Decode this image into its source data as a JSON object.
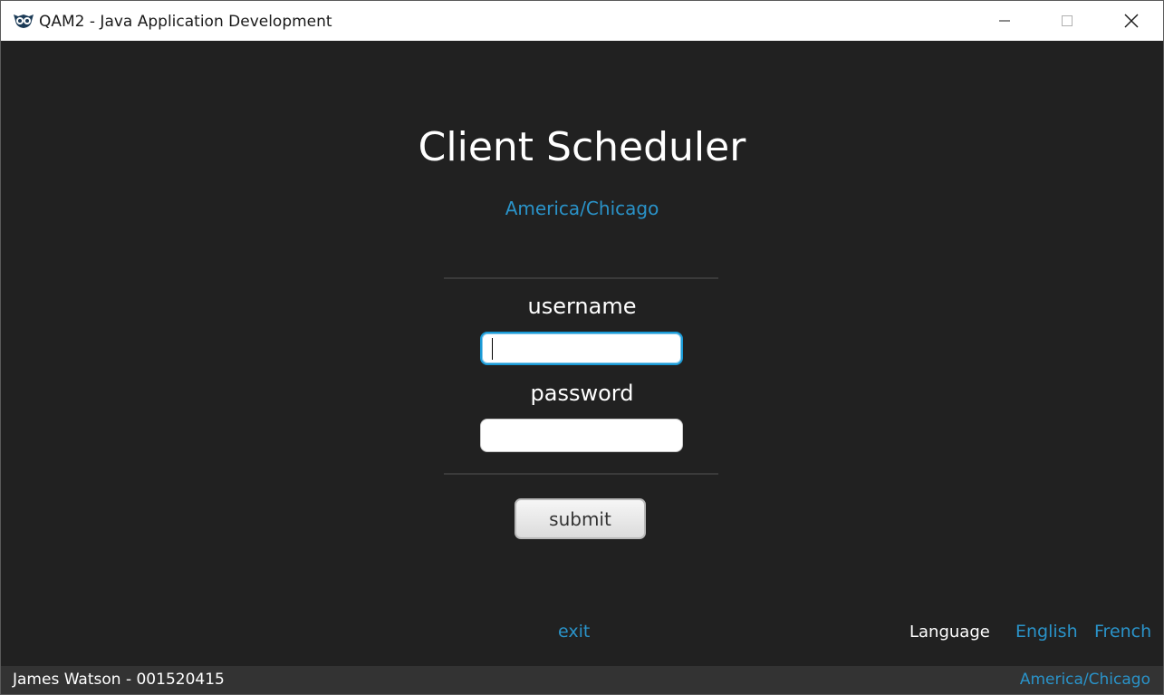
{
  "window": {
    "title": "QAM2 - Java Application Development",
    "icon": "owl-icon"
  },
  "main": {
    "title": "Client Scheduler",
    "timezone": "America/Chicago"
  },
  "form": {
    "username_label": "username",
    "username_value": "",
    "password_label": "password",
    "password_value": "",
    "submit_label": "submit"
  },
  "footer": {
    "exit_label": "exit",
    "language_label": "Language",
    "languages": [
      "English",
      "French"
    ]
  },
  "statusbar": {
    "user": "James Watson - 001520415",
    "timezone": "America/Chicago"
  },
  "colors": {
    "background": "#212121",
    "accent": "#2a93c9",
    "statusbar": "#333333"
  }
}
